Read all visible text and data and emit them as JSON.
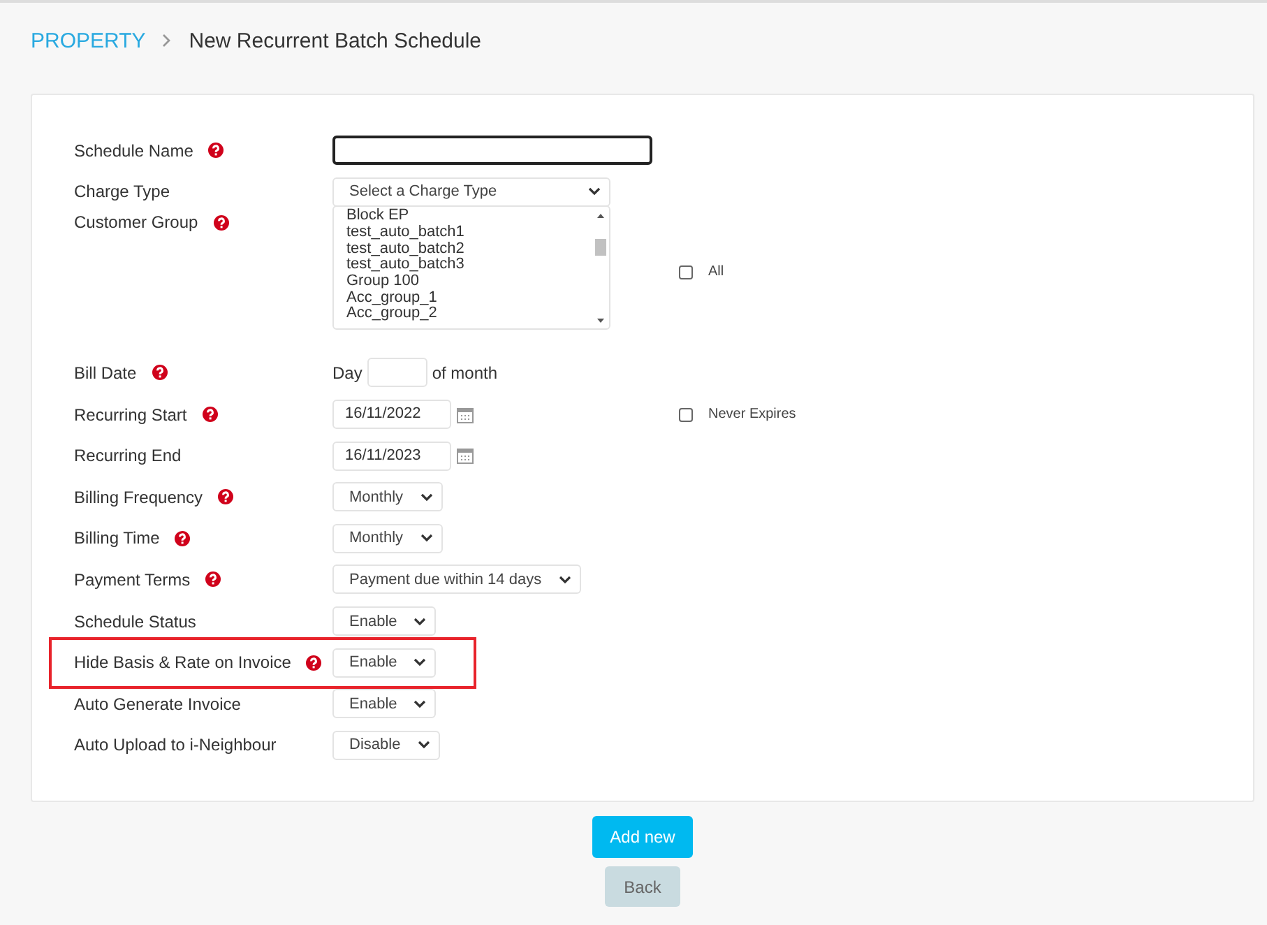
{
  "breadcrumb": {
    "parent": "PROPERTY",
    "current": "New Recurrent Batch Schedule"
  },
  "fields": [
    {
      "label": "Schedule Name",
      "help": true,
      "highlighted": false,
      "kind": "text",
      "focused": true
    },
    {
      "label": "Charge Type",
      "help": false,
      "highlighted": false,
      "kind": "select",
      "placeholder": "Select a Charge Type"
    },
    {
      "label": "Customer Group",
      "help": true,
      "highlighted": false,
      "kind": "listbox",
      "options": [
        "Block EP",
        "test_auto_batch1",
        "test_auto_batch2",
        "test_auto_batch3",
        "Group 100",
        "Acc_group_1",
        "Acc_group_2"
      ],
      "extra": {
        "label": "All",
        "checked": false
      }
    },
    {
      "label": "Bill Date",
      "help": true,
      "highlighted": false,
      "kind": "day",
      "prefix": "Day",
      "suffix": "of month"
    },
    {
      "label": "Recurring Start",
      "help": true,
      "highlighted": false,
      "kind": "date",
      "value": "16/11/2022",
      "extra": {
        "label": "Never Expires",
        "checked": false
      }
    },
    {
      "label": "Recurring End",
      "help": false,
      "highlighted": false,
      "kind": "date",
      "value": "16/11/2023"
    },
    {
      "label": "Billing Frequency",
      "help": true,
      "highlighted": false,
      "kind": "select",
      "value": "Monthly"
    },
    {
      "label": "Billing Time",
      "help": true,
      "highlighted": false,
      "kind": "select",
      "value": "Monthly"
    },
    {
      "label": "Payment Terms",
      "help": true,
      "highlighted": false,
      "kind": "select",
      "value": "Payment due within 14 days"
    },
    {
      "label": "Schedule Status",
      "help": false,
      "highlighted": false,
      "kind": "select",
      "value": "Enable"
    },
    {
      "label": "Hide Basis & Rate on Invoice",
      "help": true,
      "highlighted": true,
      "kind": "select",
      "value": "Enable"
    },
    {
      "label": "Auto Generate Invoice",
      "help": false,
      "highlighted": false,
      "kind": "select",
      "value": "Enable"
    },
    {
      "label": "Auto Upload to i-Neighbour",
      "help": false,
      "highlighted": false,
      "kind": "select",
      "value": "Disable"
    }
  ],
  "buttons": {
    "primary": "Add new",
    "secondary": "Back"
  }
}
